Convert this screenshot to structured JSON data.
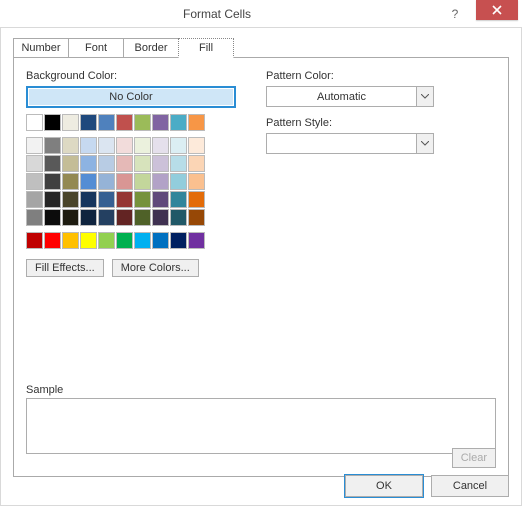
{
  "window": {
    "title": "Format Cells"
  },
  "tabs": {
    "t0": "Number",
    "t1": "Font",
    "t2": "Border",
    "t3": "Fill",
    "active": "Fill"
  },
  "fill": {
    "bg_label": "Background Color:",
    "no_color": "No Color",
    "fill_effects": "Fill Effects...",
    "more_colors": "More Colors...",
    "pattern_color_label": "Pattern Color:",
    "pattern_color_value": "Automatic",
    "pattern_style_label": "Pattern Style:",
    "pattern_style_value": "",
    "sample_label": "Sample",
    "clear": "Clear"
  },
  "footer": {
    "ok": "OK",
    "cancel": "Cancel"
  },
  "palette": {
    "row1": [
      "#ffffff",
      "#000000",
      "#eeece1",
      "#1f497d",
      "#4f81bd",
      "#c0504d",
      "#9bbb59",
      "#8064a2",
      "#4bacc6",
      "#f79646"
    ],
    "theme": [
      [
        "#f2f2f2",
        "#7f7f7f",
        "#ddd9c3",
        "#c6d9f0",
        "#dbe5f1",
        "#f2dcdb",
        "#ebf1dd",
        "#e5e0ec",
        "#dbeef3",
        "#fdeada"
      ],
      [
        "#d8d8d8",
        "#595959",
        "#c4bd97",
        "#8db3e2",
        "#b8cce4",
        "#e5b9b7",
        "#d7e3bc",
        "#ccc1d9",
        "#b7dde8",
        "#fbd5b5"
      ],
      [
        "#bfbfbf",
        "#3f3f3f",
        "#938953",
        "#548dd4",
        "#95b3d7",
        "#d99694",
        "#c3d69b",
        "#b2a2c7",
        "#92cddc",
        "#fac08f"
      ],
      [
        "#a5a5a5",
        "#262626",
        "#494429",
        "#17365d",
        "#366092",
        "#953734",
        "#76923c",
        "#5f497a",
        "#31859b",
        "#e36c09"
      ],
      [
        "#7f7f7f",
        "#0c0c0c",
        "#1d1b10",
        "#0f243e",
        "#244061",
        "#632423",
        "#4f6128",
        "#3f3151",
        "#205867",
        "#974806"
      ]
    ],
    "standard": [
      "#c00000",
      "#ff0000",
      "#ffc000",
      "#ffff00",
      "#92d050",
      "#00b050",
      "#00b0f0",
      "#0070c0",
      "#002060",
      "#7030a0"
    ]
  }
}
